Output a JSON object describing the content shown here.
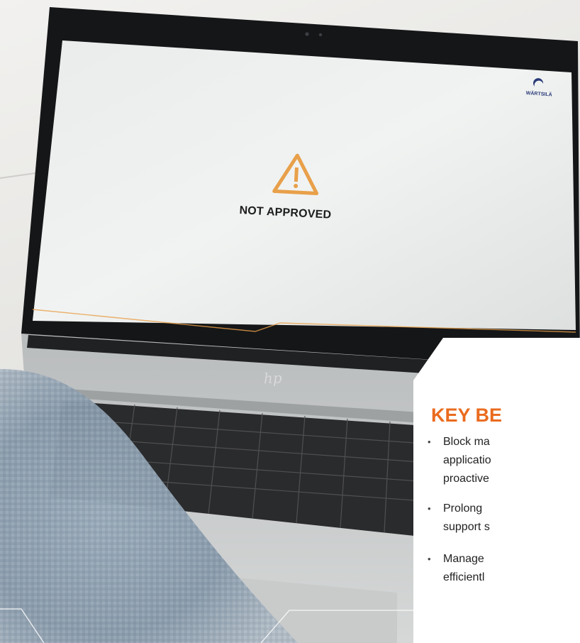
{
  "screen": {
    "brand_name": "WÄRTSILÄ",
    "warning_icon": "warning-triangle-icon",
    "status_message": "NOT APPROVED",
    "accent_color": "#e8a04a"
  },
  "panel": {
    "title": "KEY BE",
    "title_color": "#ea6b1e",
    "benefits": [
      {
        "bullet": "•",
        "text": "Block ma\napplicatio\nproactive"
      },
      {
        "bullet": "•",
        "text": "Prolong \nsupport s"
      },
      {
        "bullet": "•",
        "text": "Manage \nefficientl"
      }
    ]
  }
}
